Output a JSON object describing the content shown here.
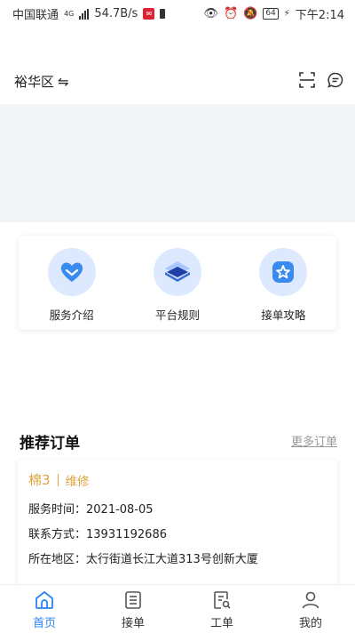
{
  "status_bar": {
    "carrier": "中国联通",
    "network": "4G",
    "speed": "54.7B/s",
    "battery": "64",
    "time": "下午2:14"
  },
  "header": {
    "location": "裕华区",
    "swap_symbol": "⇋"
  },
  "features": [
    {
      "label": "服务介绍",
      "icon": "heart-icon"
    },
    {
      "label": "平台规则",
      "icon": "layers-icon"
    },
    {
      "label": "接单攻略",
      "icon": "star-icon"
    }
  ],
  "recommend": {
    "title": "推荐订单",
    "more": "更多订单"
  },
  "order": {
    "name": "棉3",
    "type": "维修",
    "service_time": "服务时间：2021-08-05",
    "contact": "联系方式：13931192686",
    "area": "所在地区：太行街道长江大道313号创新大厦"
  },
  "tabs": [
    {
      "label": "首页",
      "icon": "home-icon"
    },
    {
      "label": "接单",
      "icon": "list-icon"
    },
    {
      "label": "工单",
      "icon": "workorder-icon"
    },
    {
      "label": "我的",
      "icon": "user-icon"
    }
  ],
  "colors": {
    "accent": "#2b83f6",
    "order_highlight": "#e0a43c",
    "icon_bg": "#dce9ff"
  }
}
